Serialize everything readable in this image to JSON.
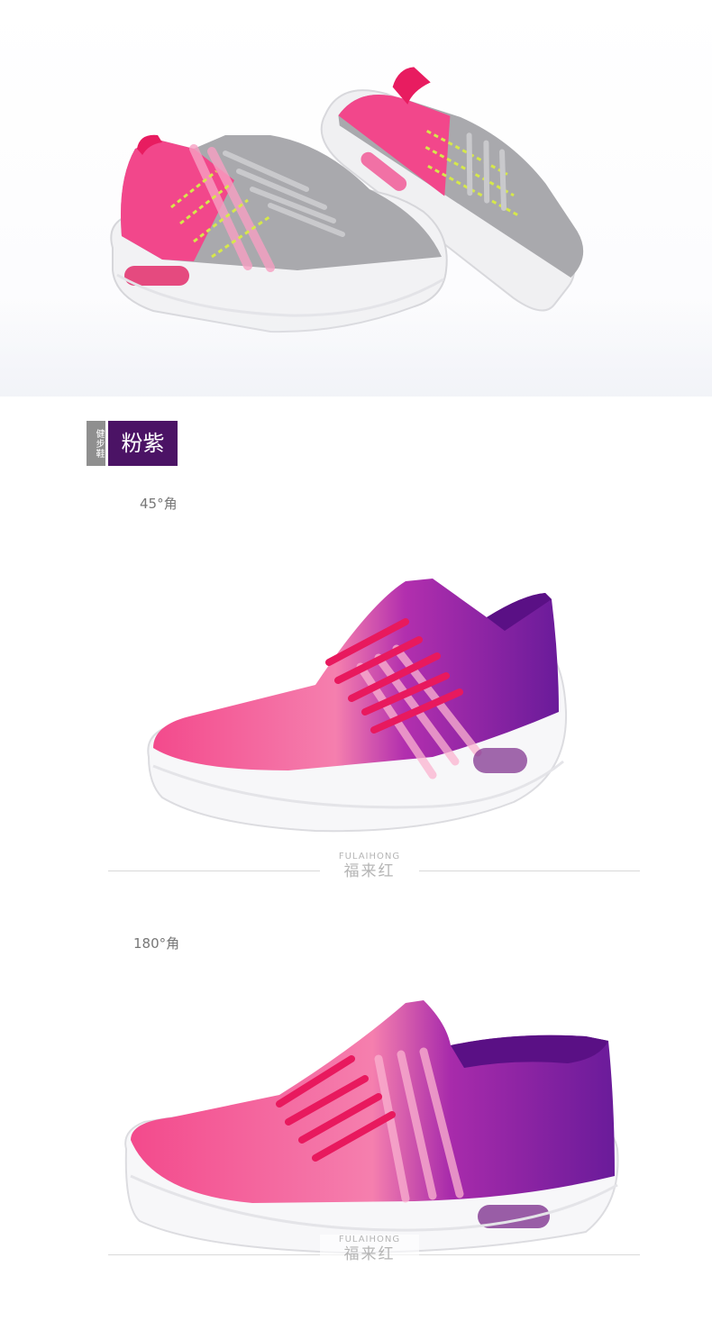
{
  "color_tag": {
    "small_label": "健步鞋",
    "color_name": "粉紫"
  },
  "views": [
    {
      "angle_label": "45°角"
    },
    {
      "angle_label": "180°角"
    }
  ],
  "brand": {
    "english": "FULAIHONG",
    "chinese": "福来红"
  },
  "colors": {
    "tag_bg": "#4b1365",
    "tag_small_bg": "#8f8f8f",
    "shoe_pink": "#f2478b",
    "shoe_purple": "#6a1b9a",
    "shoe_grey": "#a9a9ad",
    "sole_white": "#f4f4f6"
  }
}
